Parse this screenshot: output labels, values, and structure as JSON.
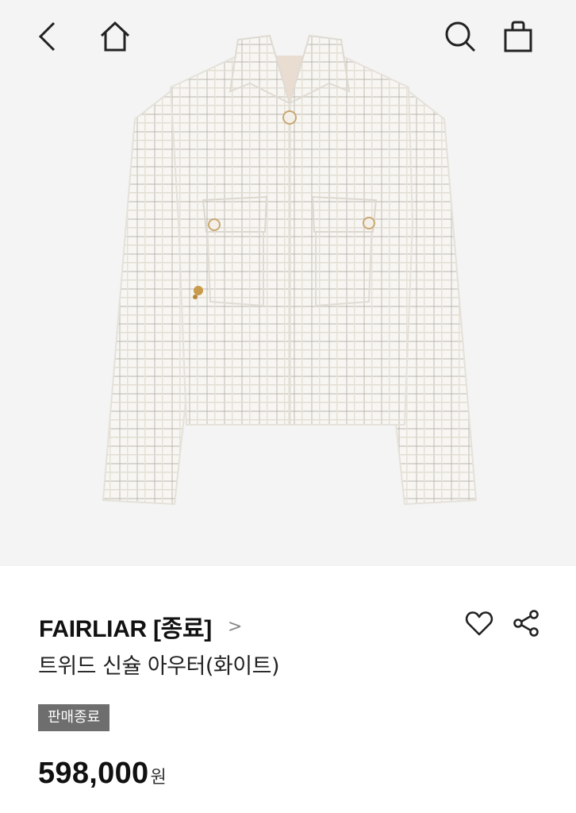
{
  "icons": {
    "back": "chevron-left-icon",
    "home": "home-icon",
    "search": "search-icon",
    "cart": "shopping-bag-icon",
    "wishlist": "heart-icon",
    "share": "share-icon"
  },
  "product": {
    "brand": "FAIRLIAR [종료]",
    "brand_chevron": ">",
    "name": "트위드 신슐 아우터(화이트)",
    "status_badge": "판매종료",
    "price": "598,000",
    "currency": "원"
  },
  "colors": {
    "hero_background": "#f4f4f4",
    "badge_background": "#6e6e6e"
  }
}
